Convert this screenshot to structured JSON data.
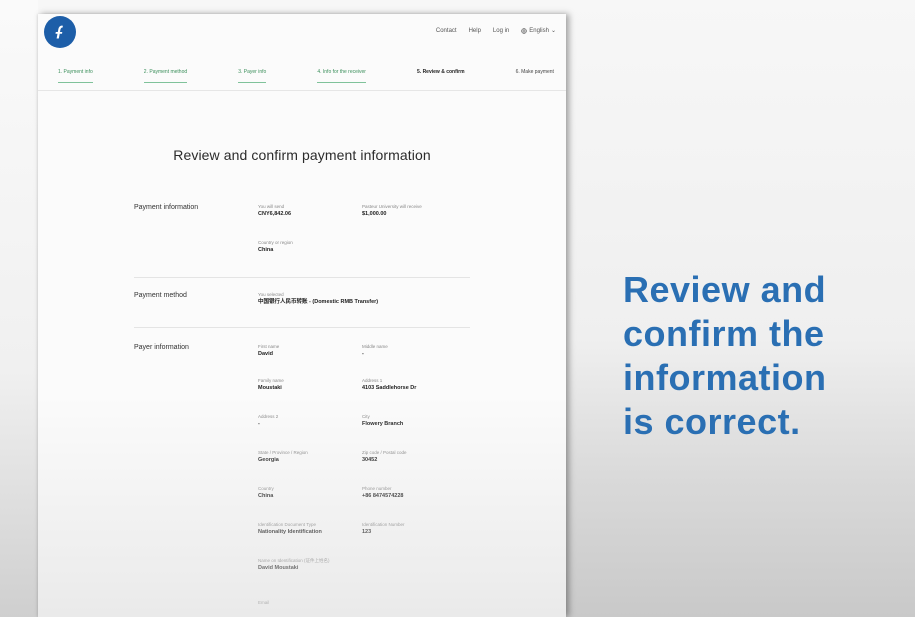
{
  "topnav": {
    "contact": "Contact",
    "help": "Help",
    "login": "Log in",
    "language": "English"
  },
  "steps": [
    {
      "label": "1. Payment info",
      "state": "done"
    },
    {
      "label": "2. Payment method",
      "state": "done"
    },
    {
      "label": "3. Payer info",
      "state": "done"
    },
    {
      "label": "4. Info for the receiver",
      "state": "done"
    },
    {
      "label": "5. Review & confirm",
      "state": "current"
    },
    {
      "label": "6. Make payment",
      "state": "future"
    }
  ],
  "page_title": "Review and confirm payment information",
  "sections": {
    "payment_info": {
      "label": "Payment information",
      "fields": [
        {
          "label": "You will send",
          "value": "CNY6,842.06"
        },
        {
          "label": "Pasteur University will receive",
          "value": "$1,000.00"
        },
        {
          "label": "Country or region",
          "value": "China"
        }
      ]
    },
    "payment_method": {
      "label": "Payment method",
      "fields": [
        {
          "label": "You selected",
          "value": "中国银行人民币转账 - (Domestic RMB Transfer)"
        }
      ]
    },
    "payer_info": {
      "label": "Payer information",
      "fields": [
        {
          "label": "First name",
          "value": "David"
        },
        {
          "label": "Middle name",
          "value": "-"
        },
        {
          "label": "Family name",
          "value": "Moustaki"
        },
        {
          "label": "Address 1",
          "value": "4103 Saddlehorse Dr"
        },
        {
          "label": "Address 2",
          "value": "-"
        },
        {
          "label": "City",
          "value": "Flowery Branch"
        },
        {
          "label": "State / Province / Region",
          "value": "Georgia"
        },
        {
          "label": "Zip code / Postal code",
          "value": "30452"
        },
        {
          "label": "Country",
          "value": "China"
        },
        {
          "label": "Phone number",
          "value": "+86 8474574228"
        },
        {
          "label": "Identification Document Type",
          "value": "Nationality Identification"
        },
        {
          "label": "Identification Number",
          "value": "123"
        },
        {
          "label": "Name on Identification (证件上姓名)",
          "value": "David Moustaki"
        },
        {
          "label": "Email",
          "value": ""
        }
      ]
    }
  },
  "overlay": {
    "lines": [
      "Review and",
      "confirm the",
      "information",
      "is correct."
    ]
  },
  "colors": {
    "brand": "#1d5ea8",
    "step_done": "#3b8f5b",
    "overlay_text": "#2a6fb3"
  }
}
